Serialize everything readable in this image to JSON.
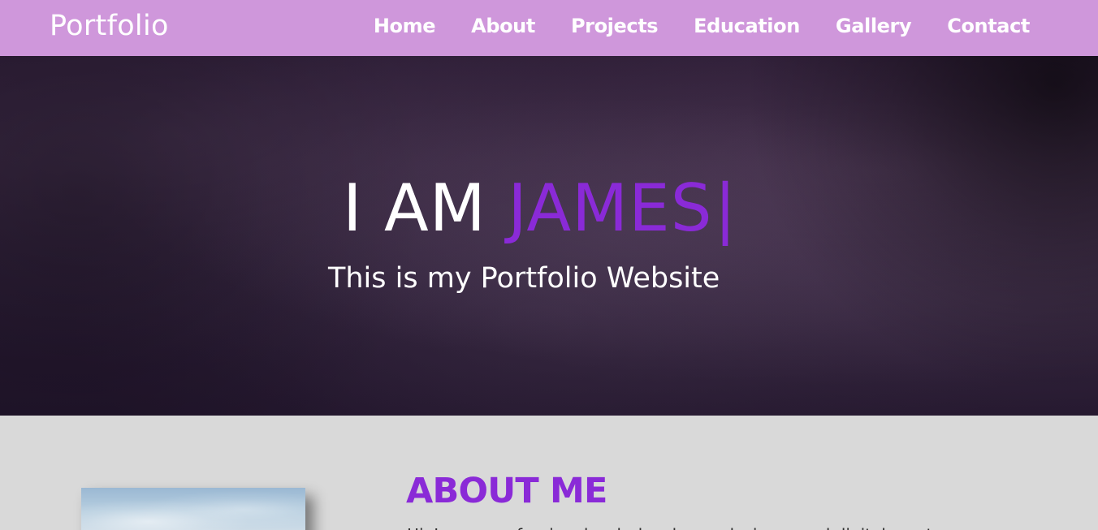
{
  "navbar": {
    "brand": "Portfolio",
    "links": [
      "Home",
      "About",
      "Projects",
      "Education",
      "Gallery",
      "Contact"
    ]
  },
  "hero": {
    "title_prefix": "I AM ",
    "title_name": "JAMES",
    "caret": "|",
    "subtitle": "This is my Portfolio Website"
  },
  "about": {
    "title": "ABOUT ME",
    "text": "Hi, I am a professional web developer, designer and digital creator"
  },
  "colors": {
    "navbar_bg": "#cf97db",
    "accent": "#8a2ad7",
    "hero_text": "#ffffff",
    "about_bg": "#d9d9d9"
  }
}
